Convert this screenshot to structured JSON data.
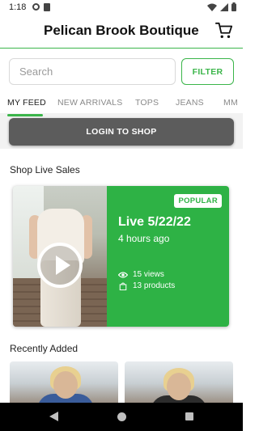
{
  "status_bar": {
    "time": "1:18"
  },
  "header": {
    "title": "Pelican Brook Boutique",
    "cart_icon": "cart-icon"
  },
  "search": {
    "placeholder": "Search",
    "value": ""
  },
  "filter": {
    "label": "FILTER"
  },
  "tabs": [
    {
      "label": "MY FEED",
      "active": true
    },
    {
      "label": "NEW ARRIVALS",
      "active": false
    },
    {
      "label": "TOPS",
      "active": false
    },
    {
      "label": "JEANS",
      "active": false
    },
    {
      "label": "MM",
      "active": false
    }
  ],
  "login": {
    "label": "LOGIN TO SHOP"
  },
  "live_sales": {
    "section_title": "Shop Live Sales",
    "card": {
      "badge": "POPULAR",
      "title": "Live 5/22/22",
      "time_ago": "4 hours ago",
      "views": "15 views",
      "products": "13 products"
    }
  },
  "recently_added": {
    "section_title": "Recently Added"
  },
  "colors": {
    "accent": "#2eb245",
    "login_button": "#5c5c5c",
    "nav_bar": "#000000"
  }
}
